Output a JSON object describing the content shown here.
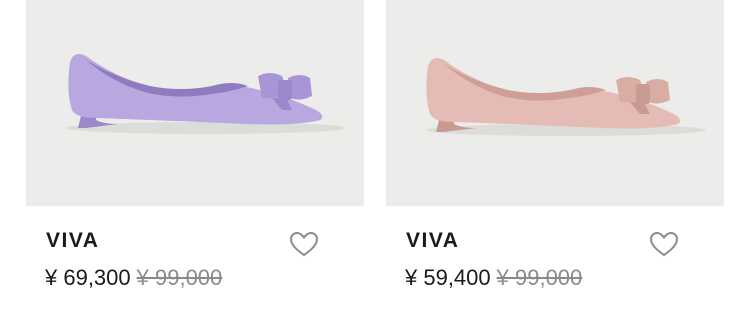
{
  "products": [
    {
      "name": "VIVA",
      "price": "¥ 69,300",
      "original_price": "¥ 99,000",
      "color": "#b9a7e0",
      "color_shade": "#9b87c9",
      "icon": "heart-outline-icon"
    },
    {
      "name": "VIVA",
      "price": "¥ 59,400",
      "original_price": "¥ 99,000",
      "color": "#e4bcb5",
      "color_shade": "#c99a92",
      "icon": "heart-outline-icon"
    }
  ]
}
